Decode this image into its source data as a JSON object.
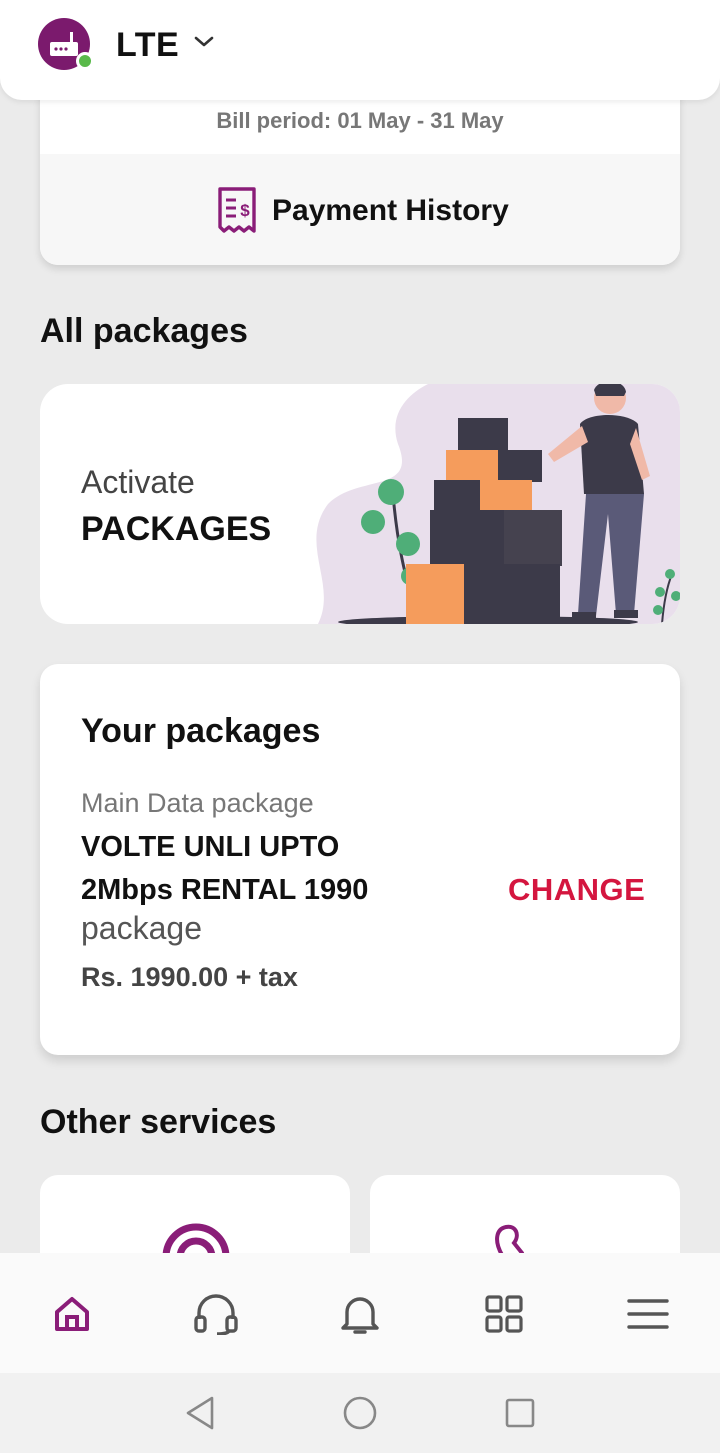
{
  "header": {
    "title": "LTE",
    "avatar_icon": "router-icon",
    "status_color": "#59b94a"
  },
  "bill": {
    "period_text": "Bill period: 01 May - 31 May",
    "payment_history_label": "Payment History",
    "payment_history_icon": "receipt-icon"
  },
  "sections": {
    "all_packages": "All packages",
    "other_services": "Other services"
  },
  "activate": {
    "line1": "Activate",
    "line2": "PACKAGES"
  },
  "your_packages": {
    "title": "Your packages",
    "package_type": "Main Data package",
    "package_name": "VOLTE UNLI UPTO 2Mbps RENTAL 1990",
    "package_suffix": "package",
    "price": "Rs. 1990.00 + tax",
    "change_label": "CHANGE"
  },
  "bottom_nav": [
    {
      "icon": "home-icon",
      "active": true
    },
    {
      "icon": "headset-icon",
      "active": false
    },
    {
      "icon": "bell-icon",
      "active": false
    },
    {
      "icon": "grid-icon",
      "active": false
    },
    {
      "icon": "menu-icon",
      "active": false
    }
  ],
  "system_nav": [
    "back-icon",
    "home-circle-icon",
    "recents-icon"
  ],
  "colors": {
    "brand": "#7b1a6d",
    "accent": "#d4163f",
    "background": "#ebebeb"
  }
}
